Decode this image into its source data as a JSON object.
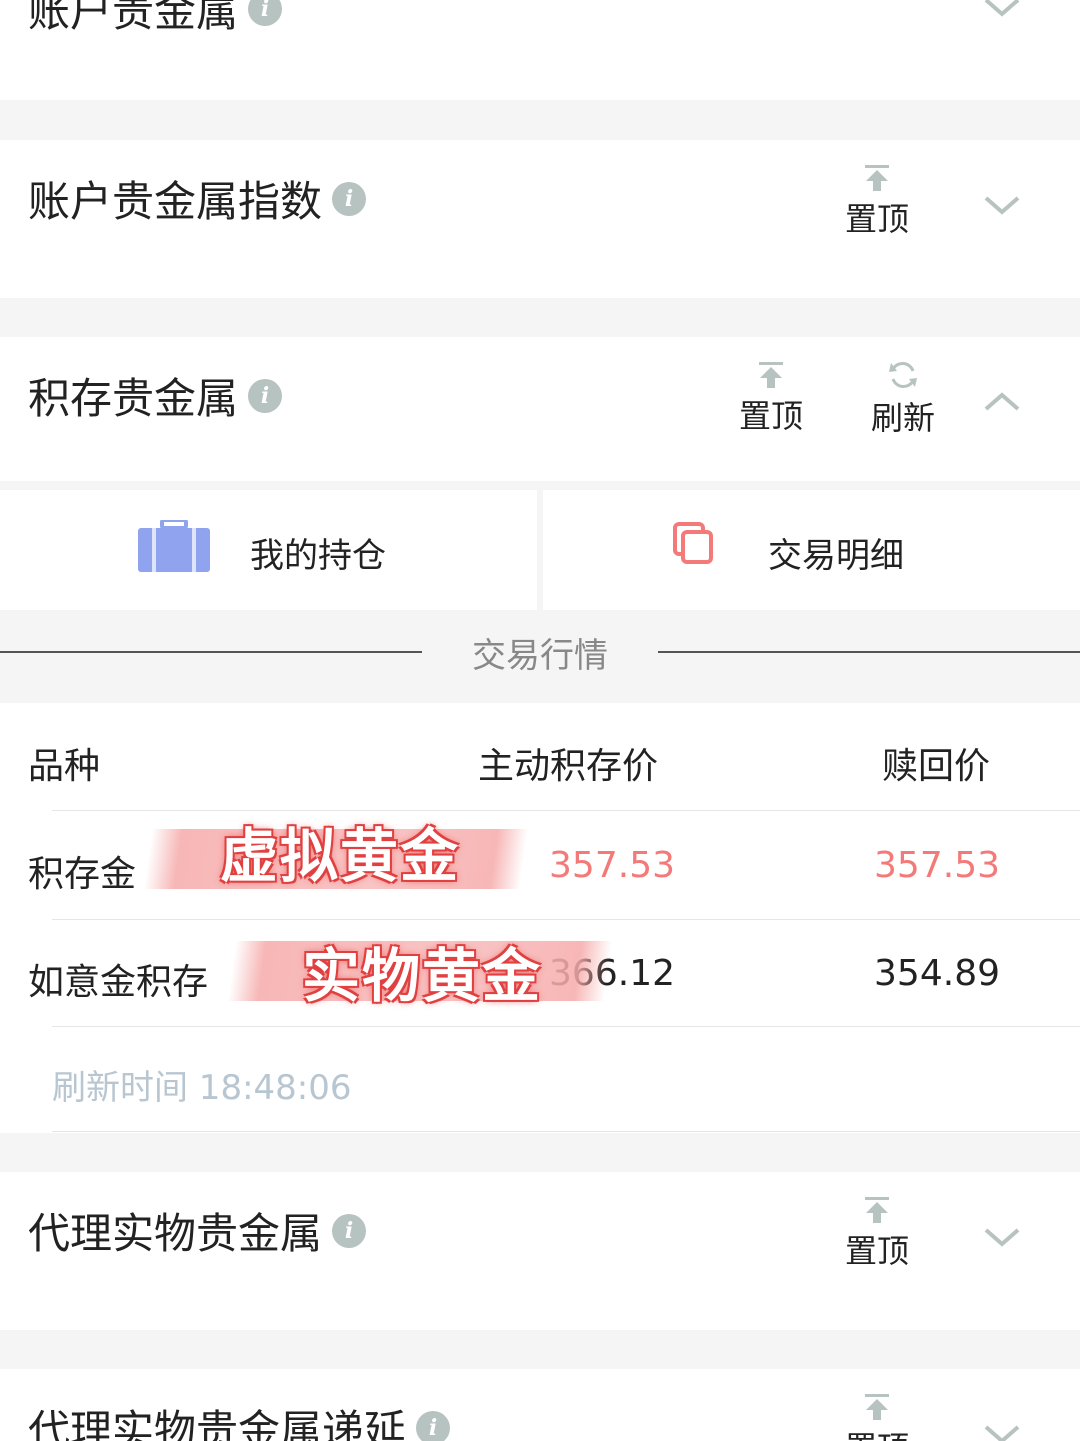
{
  "sections": {
    "s0": {
      "title": "账户贵金属"
    },
    "s1": {
      "title": "账户贵金属指数",
      "pin_label": "置顶"
    },
    "s2": {
      "title": "积存贵金属",
      "pin_label": "置顶",
      "refresh_label": "刷新"
    },
    "s3": {
      "title": "代理实物贵金属",
      "pin_label": "置顶"
    },
    "s4": {
      "title": "代理实物贵金属递延",
      "pin_label": "置顶"
    }
  },
  "info_icon": "i",
  "sub_actions": {
    "holdings": {
      "label": "我的持仓",
      "icon": "briefcase-icon",
      "color": "#8fa3ee"
    },
    "details": {
      "label": "交易明细",
      "icon": "copy-icon",
      "color": "#f47a7a"
    }
  },
  "market": {
    "title": "交易行情",
    "headers": {
      "variety": "品种",
      "buy": "主动积存价",
      "sell": "赎回价"
    },
    "rows": [
      {
        "name": "积存金",
        "buy": "357.53",
        "sell": "357.53",
        "overlay": "虚拟黄金"
      },
      {
        "name": "如意金积存",
        "buy": "366.12",
        "sell": "354.89",
        "overlay": "实物黄金"
      }
    ],
    "refresh_time": "刷新时间 18:48:06"
  },
  "colors": {
    "accent_red": "#f47a7a",
    "icon_gray": "#b7c3c1",
    "holdings_blue": "#8fa3ee"
  }
}
